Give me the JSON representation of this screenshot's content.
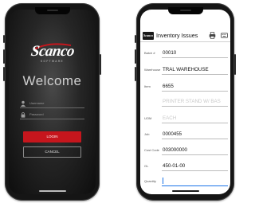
{
  "login_screen": {
    "logo_text": "Scanco",
    "logo_tagline": "SOFTWARE",
    "welcome": "Welcome",
    "username_placeholder": "Username",
    "password_placeholder": "Password",
    "login_button": "LOGIN",
    "cancel_button": "CANCEL",
    "login_color": "#c6161d"
  },
  "inventory_screen": {
    "app_logo_text": "Scanco",
    "title": "Inventory Issues",
    "header_icons": [
      "print-icon",
      "keyboard-icon"
    ],
    "fields": [
      {
        "label": "Batch #",
        "value": "00010",
        "style": "normal"
      },
      {
        "label": "Warehouse",
        "value": "TRAL WAREHOUSE",
        "style": "normal"
      },
      {
        "label": "Item",
        "value": "6655",
        "style": "normal"
      },
      {
        "label": "",
        "value": "PRINTER STAND W/ BAS",
        "style": "dim"
      },
      {
        "label": "UOM",
        "value": "EACH",
        "style": "dim"
      },
      {
        "label": "Job",
        "value": "0000455",
        "style": "normal"
      },
      {
        "label": "Cost Code",
        "value": "003000000",
        "style": "normal"
      },
      {
        "label": "GL",
        "value": "450-01-00",
        "style": "normal"
      },
      {
        "label": "Quantity",
        "value": "",
        "style": "focus"
      }
    ]
  }
}
